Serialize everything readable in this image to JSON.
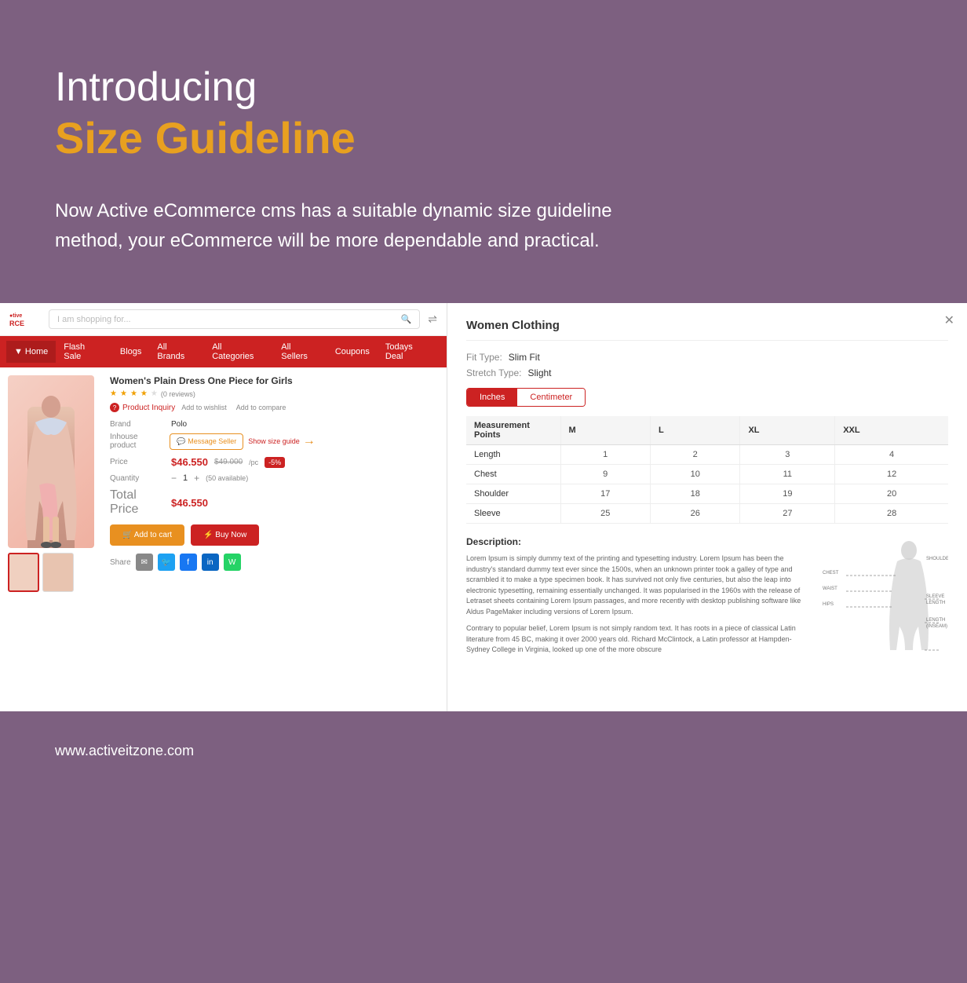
{
  "hero": {
    "introducing": "Introducing",
    "title": "Size Guideline",
    "description": "Now Active eCommerce cms has a suitable dynamic size guideline method, your eCommerce will be more dependable and practical."
  },
  "nav": {
    "logo_line1": "tive",
    "logo_line2": "RCE",
    "search_placeholder": "I am shopping for...",
    "items": [
      "Home",
      "Flash Sale",
      "Blogs",
      "All Brands",
      "All Categories",
      "All Sellers",
      "Coupons",
      "Todays Deal"
    ]
  },
  "product": {
    "name": "Women's Plain Dress One Piece for Girls",
    "stars": [
      true,
      true,
      true,
      true,
      false
    ],
    "reviews": "(0 reviews)",
    "inquiry": "Product Inquiry",
    "wishlist": "Add to wishlist",
    "compare": "Add to compare",
    "brand_label": "Brand",
    "brand_value": "Polo",
    "inhouse_label": "Inhouse product",
    "msg_seller": "Message Seller",
    "show_size": "Show size guide",
    "price_label": "Price",
    "price_current": "$46.550",
    "price_original": "$49.000",
    "price_per": "/pc",
    "discount": "-5%",
    "qty_label": "Quantity",
    "qty_value": "1",
    "qty_available": "(50 available)",
    "total_label": "Total Price",
    "total_value": "$46.550",
    "add_cart": "Add to cart",
    "buy_now": "Buy Now",
    "share_label": "Share"
  },
  "size_guide": {
    "title": "Women Clothing",
    "fit_label": "Fit Type:",
    "fit_value": "Slim Fit",
    "stretch_label": "Stretch Type:",
    "stretch_value": "Slight",
    "tab_inches": "Inches",
    "tab_centimeter": "Centimeter",
    "table_headers": [
      "Measurement Points",
      "M",
      "L",
      "XL",
      "XXL"
    ],
    "table_rows": [
      {
        "point": "Length",
        "m": "1",
        "l": "2",
        "xl": "3",
        "xxl": "4"
      },
      {
        "point": "Chest",
        "m": "9",
        "l": "10",
        "xl": "11",
        "xxl": "12"
      },
      {
        "point": "Shoulder",
        "m": "17",
        "l": "18",
        "xl": "19",
        "xxl": "20"
      },
      {
        "point": "Sleeve",
        "m": "25",
        "l": "26",
        "xl": "27",
        "xxl": "28"
      }
    ],
    "desc_title": "Description:",
    "desc_text1": "Lorem Ipsum is simply dummy text of the printing and typesetting industry. Lorem Ipsum has been the industry's standard dummy text ever since the 1500s, when an unknown printer took a galley of type and scrambled it to make a type specimen book. It has survived not only five centuries, but also the leap into electronic typesetting, remaining essentially unchanged. It was popularised in the 1960s with the release of Letraset sheets containing Lorem Ipsum passages, and more recently with desktop publishing software like Aldus PageMaker including versions of Lorem Ipsum.",
    "desc_text2": "Contrary to popular belief, Lorem Ipsum is not simply random text. It has roots in a piece of classical Latin literature from 45 BC, making it over 2000 years old. Richard McClintock, a Latin professor at Hampden-Sydney College in Virginia, looked up one of the more obscure",
    "diagram_labels": [
      "CHEST",
      "SHOULDERS",
      "WAIST",
      "SLEEVE LENGTH",
      "HIPS",
      "LENGTH (INSEAM)"
    ]
  },
  "footer": {
    "url": "www.activeitzone.com"
  },
  "colors": {
    "bg": "#7d6080",
    "accent": "#e8a020",
    "red": "#cc2222",
    "white": "#ffffff"
  }
}
